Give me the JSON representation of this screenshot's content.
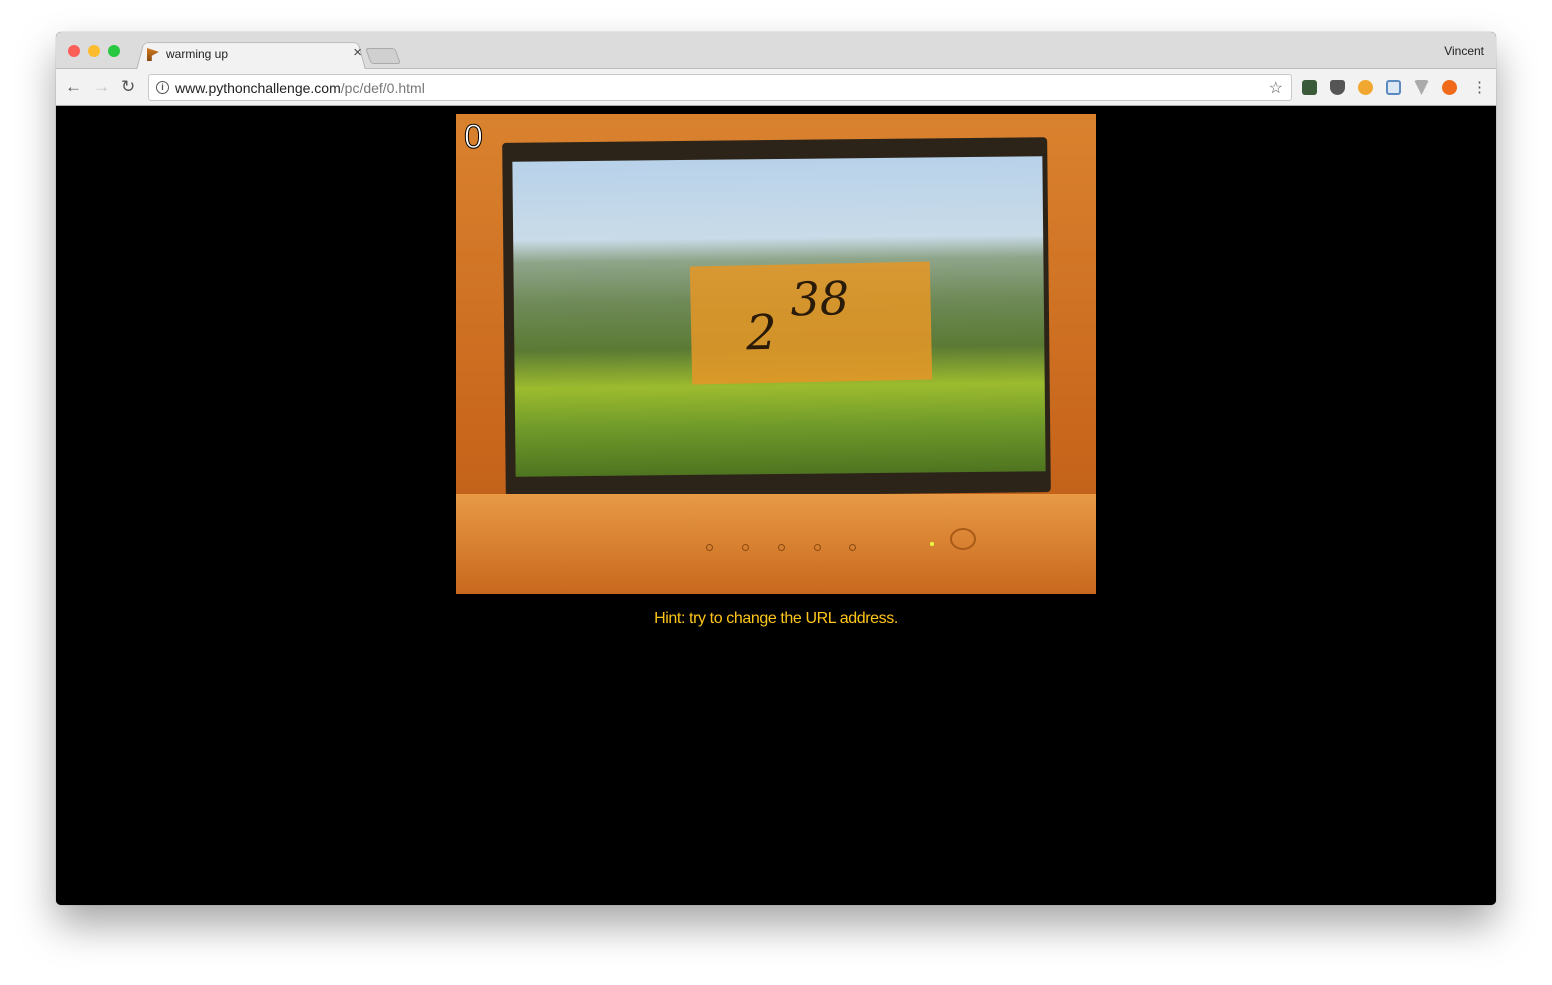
{
  "browser": {
    "tab_title": "warming up",
    "tab_close": "×",
    "profile_name": "Vincent",
    "url_host": "www.pythonchallenge.com",
    "url_path": "/pc/def/0.html",
    "info_icon": "i",
    "extensions": [
      "evernote-icon",
      "pocket-icon",
      "cookie-icon",
      "screenshot-icon",
      "vue-devtools-icon",
      "ubuntu-icon"
    ]
  },
  "page": {
    "level_number": "0",
    "image_base": "2",
    "image_exponent": "38",
    "hint": "Hint: try to change the URL address."
  },
  "colors": {
    "hint": "#ffc61a",
    "background": "#000000"
  }
}
